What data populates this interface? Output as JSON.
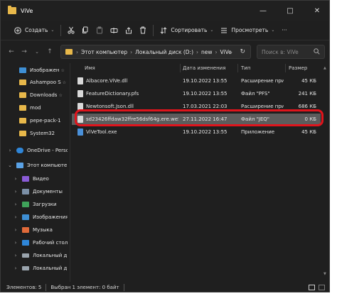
{
  "window": {
    "title": "ViVe"
  },
  "toolbar": {
    "new_label": "Создать",
    "sort_label": "Сортировать",
    "view_label": "Просмотреть",
    "more_label": "···"
  },
  "address": {
    "crumbs": [
      "Этот компьютер",
      "Локальный диск (D:)",
      "new",
      "ViVe"
    ],
    "search_placeholder": "Поиск в: ViVe"
  },
  "sidebar": {
    "items": [
      {
        "label": "Изображен",
        "pinned": true,
        "icon": "pictures-folder-icon"
      },
      {
        "label": "Ashampoo S",
        "pinned": true,
        "icon": "folder-icon"
      },
      {
        "label": "Downloads",
        "pinned": true,
        "icon": "folder-icon"
      },
      {
        "label": "mod",
        "pinned": false,
        "icon": "folder-icon"
      },
      {
        "label": "pepe-pack-1",
        "pinned": false,
        "icon": "folder-icon"
      },
      {
        "label": "System32",
        "pinned": false,
        "icon": "folder-icon"
      },
      {
        "label": "OneDrive - Perso",
        "expander": "›",
        "icon": "cloud-icon"
      },
      {
        "label": "Этот компьютер",
        "expander": "⌄",
        "icon": "computer-icon"
      },
      {
        "label": "Видео",
        "expander": "›",
        "icon": "video-folder-icon"
      },
      {
        "label": "Документы",
        "expander": "›",
        "icon": "documents-folder-icon"
      },
      {
        "label": "Загрузки",
        "expander": "›",
        "icon": "downloads-folder-icon"
      },
      {
        "label": "Изображения",
        "expander": "›",
        "icon": "pictures-folder-icon"
      },
      {
        "label": "Музыка",
        "expander": "›",
        "icon": "music-folder-icon"
      },
      {
        "label": "Рабочий стол",
        "expander": "›",
        "icon": "desktop-folder-icon"
      },
      {
        "label": "Локальный ди",
        "expander": "›",
        "icon": "drive-icon"
      },
      {
        "label": "Локальный ди",
        "expander": "›",
        "icon": "drive-icon"
      }
    ]
  },
  "table": {
    "headers": [
      "Имя",
      "Дата изменения",
      "Тип",
      "Размер"
    ],
    "rows": [
      {
        "name": "Albacore.ViVe.dll",
        "date": "19.10.2022 13:55",
        "type": "Расширение при...",
        "size": "45 КБ"
      },
      {
        "name": "FeatureDictionary.pfs",
        "date": "19.10.2022 13:55",
        "type": "Файл \"PFS\"",
        "size": "241 КБ"
      },
      {
        "name": "Newtonsoft.Json.dll",
        "date": "17.03.2021 22:03",
        "type": "Расширение при...",
        "size": "686 КБ"
      },
      {
        "name": "sd23426ffdaw32ffre56dsf64g.ere.we55.jeq",
        "date": "27.11.2022 16:47",
        "type": "Файл \"JEQ\"",
        "size": "0 КБ",
        "selected": true
      },
      {
        "name": "ViVeTool.exe",
        "date": "19.10.2022 13:55",
        "type": "Приложение",
        "size": "45 КБ"
      }
    ]
  },
  "status": {
    "items_count": "Элементов: 5",
    "selected": "Выбран 1 элемент: 0 байт"
  },
  "colors": {
    "highlight_box": "#e0141c",
    "selection": "#5c5c5c",
    "folder": "#e8b84a"
  }
}
